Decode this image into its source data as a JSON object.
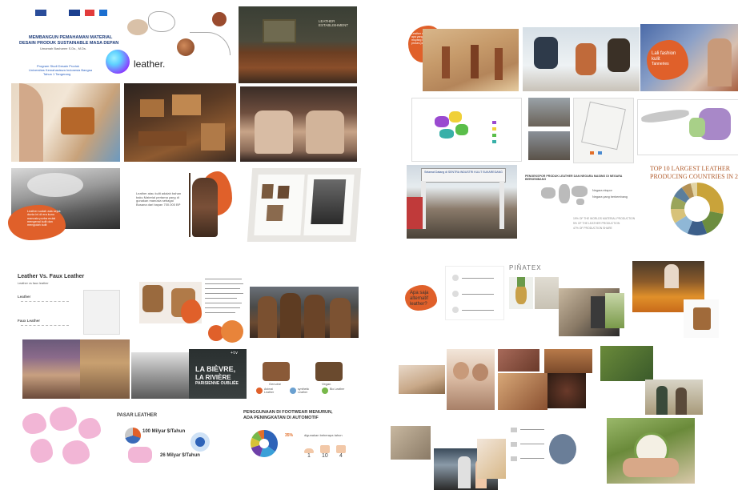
{
  "q1": {
    "title_line1": "MEMBANGUN PEMAHAMAN MATERIAL",
    "title_line2": "DESAIN PRODUK SUSTAINABLE MASA DEPAN",
    "author": "Umamah Basharee S.Ds., M.Ds.",
    "event_line1": "Program Studi Desain Produk",
    "event_line2": "Universitas Kemahasiswa Indonesia Bangsa",
    "event_line3": "Tahun 1 Tangerang",
    "leather_word": "leather.",
    "blob_text_1": "Leather sudah ada sejak dunia ini di era kuno manusia purba mulai mengenal kulit dan mengolah kulit",
    "blob_text_2": "Leather atau kulit adalah bahan baku Material pertama yang di gunakan manusia sebagai Busana dari bayan 700.000 BP",
    "fashion_label": "LEATHER ESTABLISHMENT"
  },
  "q2": {
    "blob_text": "Leather dan teknologi apa yang di ikuti nenek moyang manusia dan proses pembuatannya",
    "fashion_label_line1": "Lali fashion",
    "fashion_label_line2": "kulit",
    "fashion_label_line3": "Tanneries",
    "gate_text": "Selamat Datang di SENTRA INDUSTRI KULIT SUKAREGANG",
    "map_caption": "PENGEKSPOR PRODUK LEATHER DAN NEGARA MASING DI NEGARA BERKEMBANG",
    "legend_1": "Negara ekspor",
    "legend_2": "Negara yang berkembang",
    "chart_title_line1": "TOP 10 LARGEST LEATHER",
    "chart_title_line2": "PRODUCING COUNTRIES IN 20",
    "notes": [
      "19% OF THE WORLDS MATERIAL PRODUCTION",
      "5% OF THE LEATHER PRODUCTION",
      "47% OF PRODUCTION SHARE"
    ]
  },
  "q3": {
    "vs_title_line1": "Leather Vs. Faux Leather",
    "vs_sub": "Leather vs faux leather",
    "leather_label": "Leather",
    "faux_label": "Faux Leather",
    "movie_title_line1": "LA BIÈVRE,",
    "movie_title_line2": "LA RIVIÈRE",
    "movie_title_line3": "PARISIENNE OUBLIÉE",
    "tv_badge": "+tv",
    "jacket_1": "Genuine",
    "jacket_2": "Vegan",
    "pill_1": "Animal Leather",
    "pill_2": "synthetic Leather",
    "pill_3": "Bio Leather",
    "pasar_title": "PASAR LEATHER",
    "stat_1": "100 Milyar $/Tahun",
    "stat_2": "26 Milyar $/Tahun",
    "footwear_line1": "PENGGUNAAN DI FOOTWEAR MENURUN,",
    "footwear_line2": "ADA PENINGKATAN DI AUTOMOTIF",
    "pct_label": "35%",
    "digunakan": "digunakan beberapa tahun",
    "num_1": "1",
    "num_2": "10",
    "num_3": "4"
  },
  "q4": {
    "blob_title_line1": "Apa saja",
    "blob_title_line2": "alternatif",
    "blob_title_line3": "leather?",
    "pinatex": "PIÑATEX"
  },
  "colors": {
    "orange": "#e0602a",
    "grad_start": "#5fd1ff",
    "grad_end": "#8a3bff"
  },
  "chart_data": [
    {
      "type": "pie",
      "title": "TOP 10 LARGEST LEATHER PRODUCING COUNTRIES IN 20",
      "values": [
        28,
        16,
        12,
        10,
        9,
        8,
        7,
        6,
        4
      ],
      "colors": [
        "#c9a33a",
        "#6c8d3f",
        "#3c5f8a",
        "#8fb7d6",
        "#d7c27a",
        "#9aa55a",
        "#5b7e9c",
        "#b39155",
        "#e2d4a4"
      ]
    },
    {
      "type": "pie",
      "title": "",
      "values": [
        35,
        20,
        15,
        12,
        10,
        8
      ],
      "colors": [
        "#2e63b8",
        "#3aa0d8",
        "#6e3fa8",
        "#d8c237",
        "#78b84a",
        "#e26f2a"
      ]
    }
  ]
}
